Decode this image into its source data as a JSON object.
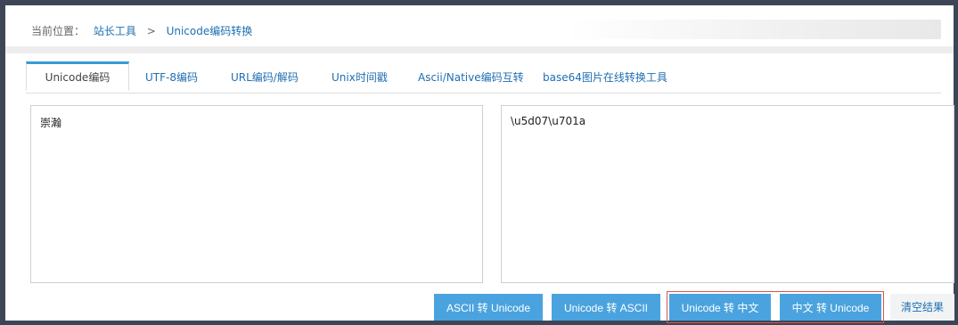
{
  "breadcrumb": {
    "prefix": "当前位置：",
    "link": "站长工具",
    "separator": ">",
    "current": "Unicode编码转换"
  },
  "tabs": [
    {
      "label": "Unicode编码",
      "active": true
    },
    {
      "label": "UTF-8编码",
      "active": false
    },
    {
      "label": "URL编码/解码",
      "active": false
    },
    {
      "label": "Unix时间戳",
      "active": false
    },
    {
      "label": "Ascii/Native编码互转",
      "active": false
    },
    {
      "label": "base64图片在线转换工具",
      "active": false
    }
  ],
  "input": {
    "value": "崇瀚"
  },
  "output": {
    "value": "\\u5d07\\u701a"
  },
  "buttons": {
    "ascii_to_unicode": "ASCII 转 Unicode",
    "unicode_to_ascii": "Unicode 转 ASCII",
    "unicode_to_chinese": "Unicode 转 中文",
    "chinese_to_unicode": "中文 转 Unicode",
    "clear": "清空结果"
  },
  "colors": {
    "accent": "#4aa3df",
    "link": "#1f6fb2",
    "highlight_border": "#d9534f",
    "background": "#3c4657"
  }
}
